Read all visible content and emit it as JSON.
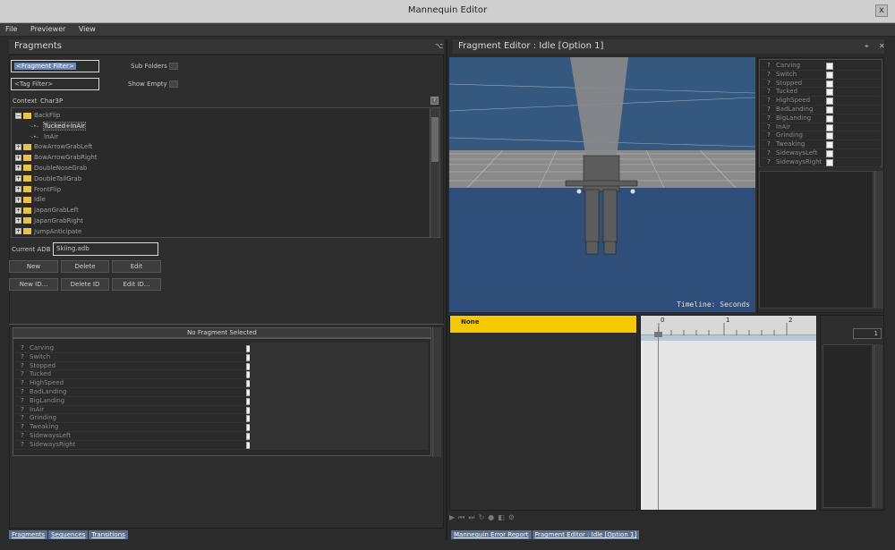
{
  "window": {
    "title": "Mannequin Editor",
    "close": "x"
  },
  "menu": [
    "File",
    "Previewer",
    "View"
  ],
  "fragments_panel": {
    "title": "Fragments",
    "pin": "⌥",
    "fragment_filter": "<Fragment Filter>",
    "tag_filter": "<Tag Filter>",
    "sub_folders_label": "Sub Folders",
    "show_empty_label": "Show Empty",
    "context_label": "Context",
    "context_value": "Char3P",
    "tree": [
      {
        "label": "BackFlip",
        "level": 0,
        "expanded": true
      },
      {
        "label": "Tucked+InAir",
        "level": 1,
        "selected": true
      },
      {
        "label": "InAir",
        "level": 1
      },
      {
        "label": "BowArrowGrabLeft",
        "level": 0
      },
      {
        "label": "BowArrowGrabRight",
        "level": 0
      },
      {
        "label": "DoubleNoseGrab",
        "level": 0
      },
      {
        "label": "DoubleTailGrab",
        "level": 0
      },
      {
        "label": "FrontFlip",
        "level": 0
      },
      {
        "label": "Idle",
        "level": 0
      },
      {
        "label": "JapanGrabLeft",
        "level": 0
      },
      {
        "label": "JapanGrabRight",
        "level": 0
      },
      {
        "label": "JumpAnticipate",
        "level": 0
      }
    ],
    "current_adb_label": "Current ADB",
    "current_adb_value": "Skiing.adb",
    "buttons_row1": [
      "New",
      "Delete",
      "Edit"
    ],
    "buttons_row2": [
      "New ID...",
      "Delete ID",
      "Edit ID..."
    ],
    "no_fragment_label": "No Fragment Selected",
    "tags": [
      "Carving",
      "Switch",
      "Stopped",
      "Tucked",
      "HighSpeed",
      "BadLanding",
      "BigLanding",
      "InAir",
      "Grinding",
      "Tweaking",
      "SidewaysLeft",
      "SidewaysRight"
    ],
    "tag_prefix": "?",
    "bottom_tabs": [
      "Fragments",
      "Sequences",
      "Transitions"
    ]
  },
  "fragment_editor": {
    "title": "Fragment Editor : Idle [Option 1]",
    "timeline_label": "Timeline: Seconds",
    "none_label": "None",
    "ruler_ticks": [
      "0",
      "1",
      "2"
    ],
    "frame_value": "1",
    "right_tags": [
      "Carving",
      "Switch",
      "Stopped",
      "Tucked",
      "HighSpeed",
      "BadLanding",
      "BigLanding",
      "InAir",
      "Grinding",
      "Tweaking",
      "SidewaysLeft",
      "SidewaysRight"
    ],
    "bottom_tabs": [
      "Mannequin Error Report",
      "Fragment Editor : Idle [Option 1]"
    ]
  },
  "colors": {
    "viewport_bg": "#2f4f7a",
    "accent_yellow": "#f5c800",
    "selection": "#6b87b3"
  }
}
